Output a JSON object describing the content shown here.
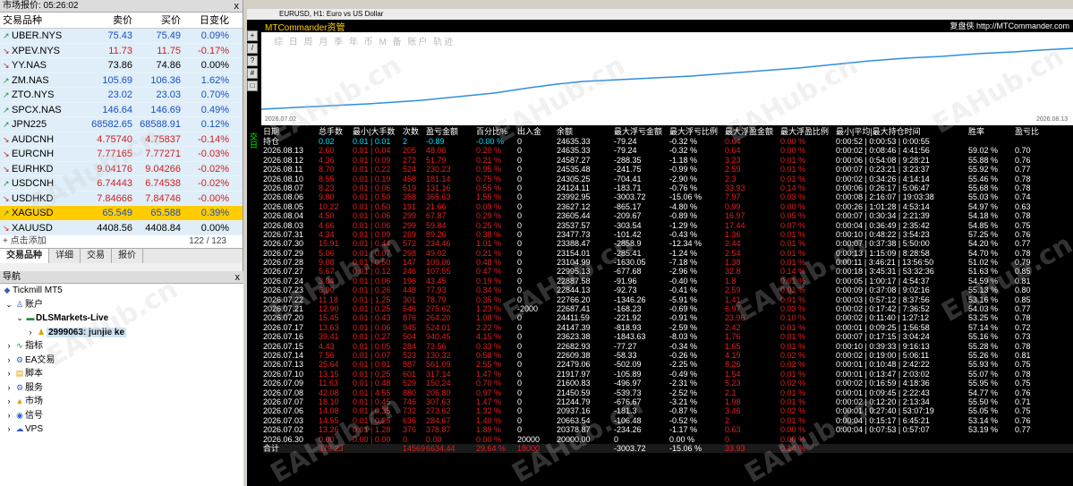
{
  "market": {
    "title": "市场报价: 05:26:02",
    "close": "x",
    "headers": [
      "交易品种",
      "卖价",
      "买价",
      "日变化"
    ],
    "rows": [
      [
        "up",
        "UBER.NYS",
        "75.43",
        "75.49",
        "0.09%",
        "up"
      ],
      [
        "dn",
        "XPEV.NYS",
        "11.73",
        "11.75",
        "-0.17%",
        "dn"
      ],
      [
        "dn",
        "YY.NAS",
        "73.86",
        "74.86",
        "0.00%",
        "w"
      ],
      [
        "up",
        "ZM.NAS",
        "105.69",
        "106.36",
        "1.62%",
        "up"
      ],
      [
        "up",
        "ZTO.NYS",
        "23.02",
        "23.03",
        "0.70%",
        "up"
      ],
      [
        "up",
        "SPCX.NAS",
        "146.64",
        "146.69",
        "0.49%",
        "up"
      ],
      [
        "up",
        "JPN225",
        "68582.65",
        "68588.91",
        "0.12%",
        "up"
      ],
      [
        "dn",
        "AUDCNH",
        "4.75740",
        "4.75837",
        "-0.14%",
        "dn"
      ],
      [
        "dn",
        "EURCNH",
        "7.77165",
        "7.77271",
        "-0.03%",
        "dn"
      ],
      [
        "dn",
        "EURHKD",
        "9.04176",
        "9.04266",
        "-0.02%",
        "dn"
      ],
      [
        "up",
        "USDCNH",
        "6.74443",
        "6.74538",
        "-0.02%",
        "dn"
      ],
      [
        "dn",
        "USDHKD",
        "7.84666",
        "7.84746",
        "-0.00%",
        "dn"
      ],
      [
        "up",
        "XAGUSD",
        "65.549",
        "65.588",
        "0.39%",
        "up"
      ],
      [
        "dn",
        "XAUUSD",
        "4408.56",
        "4408.84",
        "0.00%",
        "w"
      ]
    ],
    "add": "+ 点击添加",
    "count": "122 / 123",
    "tabs": [
      "交易品种",
      "详细",
      "交易",
      "报价"
    ]
  },
  "nav": {
    "title": "导航",
    "items": [
      "Tickmill MT5",
      "账户",
      "DLSMarkets-Live",
      "2999063: junjie ke",
      "指标",
      "EA交易",
      "脚本",
      "服务",
      "市场",
      "信号",
      "VPS"
    ]
  },
  "chart": {
    "title": "EURUSD, H1: Euro vs US Dollar",
    "brand": "MTCommander资管",
    "brand_r": "复盘侠 http://MTCommander.com",
    "tabs": "综 日 周 月 季 年 币 M 备 账户        轨迹",
    "start": "2026.07.02",
    "end": "2026.08.13",
    "side": "交日"
  },
  "table": {
    "headers": [
      "日期",
      "总手数",
      "最小|大手数",
      "次数",
      "盈亏金额",
      "百分比%",
      "出入金",
      "余额",
      "最大浮亏金额",
      "最大浮亏比例",
      "最大浮盈金额",
      "最大浮盈比例",
      "最小|平均|最大持仓时间",
      "胜率",
      "盈亏比"
    ],
    "rows": [
      [
        "持仓",
        "0.02",
        "0.01 | 0.01",
        "2",
        "-0.89",
        "-0.00 %",
        "0",
        "24635.33",
        "-79.24",
        "-0.32 %",
        "0.64",
        "0.00 %",
        "0:00:52 | 0:00:53 | 0:00:55",
        "",
        ""
      ],
      [
        "2026.08.13",
        "2.60",
        "0.01 | 0.04",
        "205",
        "48.06",
        "0.20 %",
        "0",
        "24635.33",
        "-79.24",
        "-0.32 %",
        "0.64",
        "0.00 %",
        "0:00:02 | 0:08:46 | 4:41:56",
        "59.02 %",
        "0.70"
      ],
      [
        "2026.08.12",
        "4.36",
        "0.01 | 0.09",
        "272",
        "51.79",
        "0.21 %",
        "0",
        "24587.27",
        "-288.35",
        "-1.18 %",
        "3.23",
        "0.01 %",
        "0:00:06 | 0:54:08 | 9:28:21",
        "55.88 %",
        "0.76"
      ],
      [
        "2026.08.11",
        "8.70",
        "0.01 | 0.22",
        "524",
        "230.23",
        "0.95 %",
        "0",
        "24535.48",
        "-241.75",
        "-0.99 %",
        "2.59",
        "0.01 %",
        "0:00:07 | 0:23:21 | 3:23:37",
        "55.92 %",
        "0.77"
      ],
      [
        "2026.08.10",
        "8.55",
        "0.01 | 0.19",
        "458",
        "181.14",
        "0.75 %",
        "0",
        "24305.25",
        "-704.41",
        "-2.90 %",
        "2.3",
        "0.01 %",
        "0:00:02 | 0:34:26 | 4:14:14",
        "55.46 %",
        "0.78"
      ],
      [
        "2026.08.07",
        "8.23",
        "0.01 | 0.06",
        "519",
        "131.16",
        "0.55 %",
        "0",
        "24124.11",
        "-183.71",
        "-0.76 %",
        "33.93",
        "0.14 %",
        "0:00:06 | 0:26:17 | 5:06:47",
        "55.68 %",
        "0.78"
      ],
      [
        "2026.08.06",
        "9.80",
        "0.01 | 0.50",
        "358",
        "365.63",
        "1.55 %",
        "0",
        "23992.95",
        "-3003.72",
        "-15.06 %",
        "7.97",
        "0.03 %",
        "0:00:08 | 2:16:07 | 19:03:38",
        "55.03 %",
        "0.74"
      ],
      [
        "2026.08.05",
        "10.22",
        "0.01 | 0.50",
        "191",
        "21.66",
        "0.09 %",
        "0",
        "23627.12",
        "-865.17",
        "-4.80 %",
        "0.99",
        "0.00 %",
        "0:00:26 | 1:01:28 | 4:53:14",
        "54.97 %",
        "0.63"
      ],
      [
        "2026.08.04",
        "4.50",
        "0.01 | 0.06",
        "299",
        "67.87",
        "0.29 %",
        "0",
        "23605.44",
        "-209.67",
        "-0.89 %",
        "16.97",
        "0.05 %",
        "0:00:07 | 0:30:34 | 2:21:39",
        "54.18 %",
        "0.78"
      ],
      [
        "2026.08.03",
        "4.66",
        "0.01 | 0.06",
        "299",
        "59.84",
        "0.25 %",
        "0",
        "23537.57",
        "-303.54",
        "-1.29 %",
        "17.44",
        "0.07 %",
        "0:00:04 | 0:36:49 | 2:35:42",
        "54.85 %",
        "0.75"
      ],
      [
        "2026.07.31",
        "4.34",
        "0.01 | 0.09",
        "269",
        "89.26",
        "0.38 %",
        "0",
        "23477.73",
        "-101.42",
        "-0.43 %",
        "1.36",
        "0.01 %",
        "0:00:10 | 0:48:22 | 3:54:23",
        "57.25 %",
        "0.76"
      ],
      [
        "2026.07.30",
        "15.91",
        "0.01 | 0.44",
        "572",
        "234.46",
        "1.01 %",
        "0",
        "23388.47",
        "-2858.9",
        "-12.34 %",
        "2.44",
        "0.01 %",
        "0:00:07 | 0:37:38 | 5:50:00",
        "54.20 %",
        "0.77"
      ],
      [
        "2026.07.29",
        "5.06",
        "0.01 | 0.07",
        "298",
        "49.02",
        "0.21 %",
        "0",
        "23154.01",
        "-285.41",
        "-1.24 %",
        "2.54",
        "0.01 %",
        "0:00:13 | 1:15:09 | 8:28:58",
        "54.70 %",
        "0.78"
      ],
      [
        "2026.07.28",
        "9.08",
        "0.01 | 0.50",
        "147",
        "109.06",
        "0.48 %",
        "0",
        "23104.99",
        "-1630.05",
        "-7.18 %",
        "1.38",
        "0.01 %",
        "0:00:11 | 3:46:21 | 13:56:50",
        "51.02 %",
        "0.79"
      ],
      [
        "2026.07.27",
        "5.67",
        "0.01 | 0.12",
        "246",
        "107.55",
        "0.47 %",
        "0",
        "22995.13",
        "-677.68",
        "-2.96 %",
        "32.8",
        "0.14 %",
        "0:00:18 | 3:45:31 | 53:32:36",
        "51.63 %",
        "0.85"
      ],
      [
        "2026.07.24",
        "3.04",
        "0.01 | 0.06",
        "196",
        "43.45",
        "0.19 %",
        "0",
        "22887.58",
        "-91.96",
        "-0.40 %",
        "1.8",
        "0.01 %",
        "0:00:05 | 1:00:17 | 4:54:37",
        "54.59 %",
        "0.81"
      ],
      [
        "2026.07.23",
        "6.90",
        "0.01 | 0.26",
        "448",
        "77.93",
        "0.34 %",
        "0",
        "22844.13",
        "-92.73",
        "-0.41 %",
        "2.59",
        "0.01 %",
        "0:00:09 | 0:37:08 | 9:02:16",
        "55.13 %",
        "0.80"
      ],
      [
        "2026.07.22",
        "11.18",
        "0.01 | 1.25",
        "301",
        "78.79",
        "0.35 %",
        "0",
        "22766.20",
        "-1346.26",
        "-5.91 %",
        "1.41",
        "0.01 %",
        "0:00:03 | 0:57:12 | 8:37:56",
        "53.16 %",
        "0.85"
      ],
      [
        "2026.07.21",
        "12.90",
        "0.01 | 0.25",
        "546",
        "275.62",
        "1.23 %",
        "-2000",
        "22687.41",
        "-168.23",
        "-0.69 %",
        "6.97",
        "0.03 %",
        "0:00:02 | 0:17:42 | 7:36:52",
        "54.03 %",
        "0.77"
      ],
      [
        "2026.07.20",
        "15.45",
        "0.01 | 0.43",
        "876",
        "264.20",
        "1.08 %",
        "0",
        "24411.59",
        "-221.92",
        "-0.91 %",
        "23.96",
        "0.10 %",
        "0:00:02 | 0:11:40 | 1:27:12",
        "53.25 %",
        "0.78"
      ],
      [
        "2026.07.17",
        "13.63",
        "0.01 | 0.06",
        "945",
        "524.01",
        "2.22 %",
        "0",
        "24147.39",
        "-818.93",
        "-2.59 %",
        "2.42",
        "0.01 %",
        "0:00:01 | 0:09:25 | 1:56:58",
        "57.14 %",
        "0.72"
      ],
      [
        "2026.07.16",
        "39.41",
        "0.01 | 0.27",
        "504",
        "940.45",
        "4.15 %",
        "0",
        "23623.38",
        "-1843.63",
        "-8.03 %",
        "1.76",
        "0.01 %",
        "0:00:07 | 0:17:15 | 3:04:24",
        "55.16 %",
        "0.73"
      ],
      [
        "2026.07.15",
        "4.43",
        "0.01 | 0.05",
        "284",
        "73.56",
        "0.33 %",
        "0",
        "22682.93",
        "-77.27",
        "-0.34 %",
        "1.65",
        "0.01 %",
        "0:00:10 | 0:39:33 | 9:16:13",
        "55.28 %",
        "0.78"
      ],
      [
        "2026.07.14",
        "7.56",
        "0.01 | 0.07",
        "523",
        "130.32",
        "0.58 %",
        "0",
        "22609.38",
        "-58.33",
        "-0.26 %",
        "4.19",
        "0.02 %",
        "0:00:02 | 0:19:00 | 5:06:11",
        "55.26 %",
        "0.81"
      ],
      [
        "2026.07.13",
        "25.64",
        "0.01 | 0.91",
        "887",
        "561.09",
        "2.55 %",
        "0",
        "22479.06",
        "-502.09",
        "-2.25 %",
        "8.26",
        "0.02 %",
        "0:00:01 | 0:10:48 | 2:42:22",
        "55.93 %",
        "0.75"
      ],
      [
        "2026.07.10",
        "13.15",
        "0.01 | 0.25",
        "601",
        "317.14",
        "1.47 %",
        "0",
        "21917.97",
        "-105.89",
        "-0.49 %",
        "1.54",
        "0.01 %",
        "0:00:01 | 0:13:47 | 2:03:02",
        "55.07 %",
        "0.78"
      ],
      [
        "2026.07.09",
        "11.63",
        "0.01 | 0.48",
        "529",
        "150.24",
        "0.70 %",
        "0",
        "21600.83",
        "-496.97",
        "-2.31 %",
        "5.23",
        "0.02 %",
        "0:00:02 | 0:16:59 | 4:18:36",
        "55.95 %",
        "0.75"
      ],
      [
        "2026.07.08",
        "42.08",
        "0.01 | 4.55",
        "880",
        "205.80",
        "0.97 %",
        "0",
        "21450.59",
        "-539.73",
        "-2.52 %",
        "2.1",
        "0.01 %",
        "0:00:01 | 0:09:45 | 2:22:43",
        "54.77 %",
        "0.76"
      ],
      [
        "2026.07.07",
        "18.10",
        "0.01 | 0.45",
        "746",
        "307.63",
        "1.47 %",
        "0",
        "21244.79",
        "-676.67",
        "-3.21 %",
        "1.98",
        "0.01 %",
        "0:00:02 | 0:12:20 | 2:13:34",
        "55.50 %",
        "0.71"
      ],
      [
        "2026.07.06",
        "14.08",
        "0.01 | 0.35",
        "732",
        "273.62",
        "1.32 %",
        "0",
        "20937.16",
        "-181.3",
        "-0.87 %",
        "3.46",
        "0.02 %",
        "0:00:01 | 0:27:40 | 53:07:19",
        "55.05 %",
        "0.75"
      ],
      [
        "2026.07.03",
        "14.55",
        "0.01 | 0.25",
        "636",
        "284.67",
        "1.40 %",
        "0",
        "20663.54",
        "-106.48",
        "-0.52 %",
        "2",
        "0.01 %",
        "0:00:04 | 0:15:17 | 6:45:21",
        "53.14 %",
        "0.76"
      ],
      [
        "2026.07.02",
        "13.26",
        "0.01 | 1.28",
        "376",
        "378.87",
        "1.89 %",
        "0",
        "20378.87",
        "-234.26",
        "-1.17 %",
        "0.63",
        "0.00 %",
        "0:00:04 | 0:07:53 | 0:57:07",
        "53.19 %",
        "0.77"
      ],
      [
        "2026.06.30",
        "0.00",
        "0.00 | 0.00",
        "0",
        "0.00",
        "0.00 %",
        "20000",
        "20000.00",
        "0",
        "0.00 %",
        "0",
        "0.00 %",
        "",
        "",
        ""
      ]
    ],
    "sum": [
      "合计",
      "379.23",
      "",
      "14569",
      "6634.44",
      "29.64 %",
      "18000",
      "",
      "-3003.72",
      "-15.06 %",
      "33.93",
      "0.14 %",
      "",
      "",
      ""
    ]
  },
  "watermark": "EAHub.cn"
}
